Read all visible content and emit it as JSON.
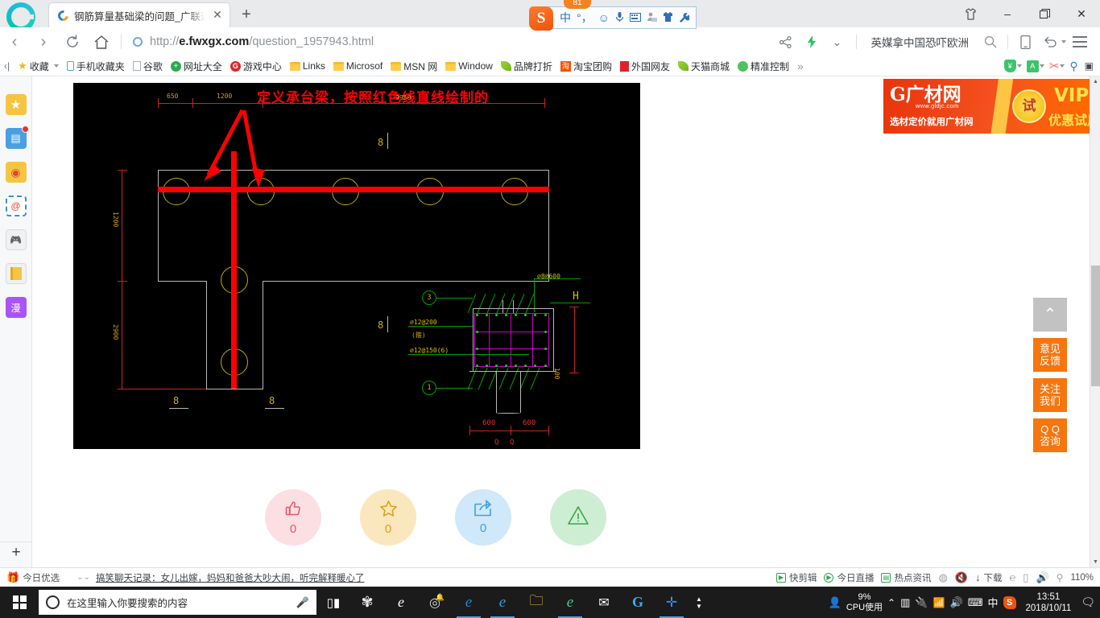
{
  "window": {
    "minimize": "–",
    "maximize": "❐",
    "close": "✕",
    "collect_icon": "shirt-icon"
  },
  "tabs": {
    "active_title": "钢筋算量基础梁的问题_广联达服",
    "close_label": "✕",
    "new_tab_label": "+"
  },
  "ime": {
    "logo": "S",
    "badge": "81",
    "items": [
      "中",
      "°，",
      "☺",
      "🎙",
      "⌨",
      "👤",
      "👕",
      "🔧"
    ]
  },
  "nav": {
    "back": "‹",
    "forward": "›",
    "reload": "↻",
    "home": "⌂",
    "url_prefix": "http://",
    "url_domain": "e.fwxgx.com",
    "url_path": "/question_1957943.html",
    "share_icon": "share-icon",
    "bolt_icon": "lightning-icon",
    "chevron": "⌄",
    "hotword": "英媒拿中国恐吓欧洲",
    "search_icon": "search-icon",
    "mobile_icon": "phone-icon",
    "undo_icon": "undo-icon",
    "menu_icon": "menu-icon"
  },
  "bookmarks": {
    "overflow_left": "‹|",
    "items": [
      {
        "label": "收藏",
        "icon": "star-icon",
        "has_caret": true
      },
      {
        "label": "手机收藏夹",
        "icon": "phone-icon"
      },
      {
        "label": "谷歌",
        "icon": "page-icon"
      },
      {
        "label": "网址大全",
        "icon": "plus-circle-icon"
      },
      {
        "label": "游戏中心",
        "icon": "g-circle-icon"
      },
      {
        "label": "Links",
        "icon": "folder-icon"
      },
      {
        "label": "Microsof",
        "icon": "folder-icon"
      },
      {
        "label": "MSN 网",
        "icon": "folder-icon"
      },
      {
        "label": "Window",
        "icon": "folder-icon"
      },
      {
        "label": "品牌打折",
        "icon": "leaf-icon"
      },
      {
        "label": "淘宝团购",
        "icon": "taobao-icon"
      },
      {
        "label": "外国网友",
        "icon": "red-flag-icon"
      },
      {
        "label": "天猫商城",
        "icon": "leaf-icon"
      },
      {
        "label": "精准控制",
        "icon": "green-circle-icon"
      }
    ],
    "overflow_right": "»",
    "tools": [
      "shield-yen-icon",
      "translate-icon",
      "scissors-icon",
      "magnifier-icon",
      "grid-add-icon"
    ]
  },
  "left_rail": {
    "items": [
      {
        "name": "favorites",
        "glyph": "★"
      },
      {
        "name": "news",
        "glyph": "▤",
        "badge": true
      },
      {
        "name": "weibo",
        "glyph": "◉"
      },
      {
        "name": "email",
        "glyph": "@"
      },
      {
        "name": "games",
        "glyph": "⌨"
      },
      {
        "name": "bookshelf",
        "glyph": "▭"
      },
      {
        "name": "comics",
        "glyph": "漫"
      }
    ],
    "add_label": "+"
  },
  "cad": {
    "annotation": "定义承台梁，按照红色线直线绘制的",
    "dims": {
      "d650": "650",
      "d1200_top": "1200",
      "d1200_left": "1200",
      "d2900": "2900",
      "d9950": "9950"
    },
    "marks": {
      "m1": "8",
      "m2": "8",
      "m3": "8",
      "m4": "8"
    },
    "detail": {
      "bubble_top": "3",
      "bubble_bottom": "1",
      "rebar_top": "⌀8@600",
      "rebar_left1": "⌀12@200",
      "rebar_left1b": "(箍)",
      "rebar_left2": "⌀12@150(6)",
      "letter_h": "H",
      "dim_left": "600",
      "dim_right": "600",
      "base_left": "Q",
      "base_right": "Q",
      "dim_100": "100"
    }
  },
  "reactions": [
    {
      "name": "like",
      "icon": "thumbs-up-icon",
      "count": "0",
      "bg": "#fcdfe3",
      "fg": "#e8566e"
    },
    {
      "name": "favorite",
      "icon": "star-icon",
      "count": "0",
      "bg": "#fbe7bd",
      "fg": "#d9a017"
    },
    {
      "name": "share",
      "icon": "share-box-icon",
      "count": "0",
      "bg": "#cfe8fa",
      "fg": "#3f9fe0"
    },
    {
      "name": "report",
      "icon": "warning-triangle-icon",
      "count": "",
      "bg": "#cdeed2",
      "fg": "#3aa54c"
    }
  ],
  "ad": {
    "brand_g": "G",
    "brand_name": "广材网",
    "url": "www.gldjc.com",
    "subtitle": "选材定价就用广材网",
    "badge": "试",
    "vip": "VIP",
    "offer": "优惠试用"
  },
  "float_buttons": [
    {
      "name": "scroll-top",
      "line1": "⌃",
      "line2": ""
    },
    {
      "name": "feedback",
      "line1": "意见",
      "line2": "反馈"
    },
    {
      "name": "follow-us",
      "line1": "关注",
      "line2": "我们"
    },
    {
      "name": "qq-consult",
      "line1": "Q Q",
      "line2": "咨询"
    }
  ],
  "statusbar": {
    "gift_label": "今日优选",
    "expand": "⌄⌄",
    "news": "搞笑聊天记录：女儿出嫁，妈妈和爸爸大吵大闹，听完解释暖心了",
    "tools": [
      {
        "label": "快剪辑",
        "icon": "play-box-icon"
      },
      {
        "label": "今日直播",
        "icon": "play-circle-icon"
      },
      {
        "label": "热点资讯",
        "icon": "news-box-icon"
      }
    ],
    "icons": [
      "compass-icon",
      "mute-mic-icon",
      "download-icon",
      "e-icon",
      "window-icon",
      "volume-icon",
      "search-icon"
    ],
    "download_label": "下载",
    "zoom": "110%"
  },
  "taskbar": {
    "search_placeholder": "在这里输入你要搜索的内容",
    "mic_icon": "microphone-icon",
    "pinned": [
      {
        "name": "task-view",
        "glyph": "⌸"
      },
      {
        "name": "app-fan",
        "glyph": "✻"
      },
      {
        "name": "edge",
        "glyph": "e"
      },
      {
        "name": "spiral-app",
        "glyph": "◎"
      },
      {
        "name": "ie-blue",
        "glyph": "e"
      },
      {
        "name": "ie-classic",
        "glyph": "e"
      },
      {
        "name": "file-explorer",
        "glyph": "▭"
      },
      {
        "name": "browser-360",
        "glyph": "e"
      },
      {
        "name": "mail",
        "glyph": "✉"
      },
      {
        "name": "g-app",
        "glyph": "G"
      },
      {
        "name": "blue-app",
        "glyph": "✤"
      }
    ],
    "tray": {
      "people_icon": "people-icon",
      "cpu_value": "9%",
      "cpu_label": "CPU使用",
      "chevron": "⌃",
      "icons": [
        "battery-icon",
        "plug-icon",
        "wifi-icon",
        "volume-icon",
        "keyboard-icon"
      ],
      "ime_mode": "中",
      "sogou": "S",
      "time": "13:51",
      "date": "2018/10/11",
      "notify_icon": "notification-icon"
    }
  }
}
